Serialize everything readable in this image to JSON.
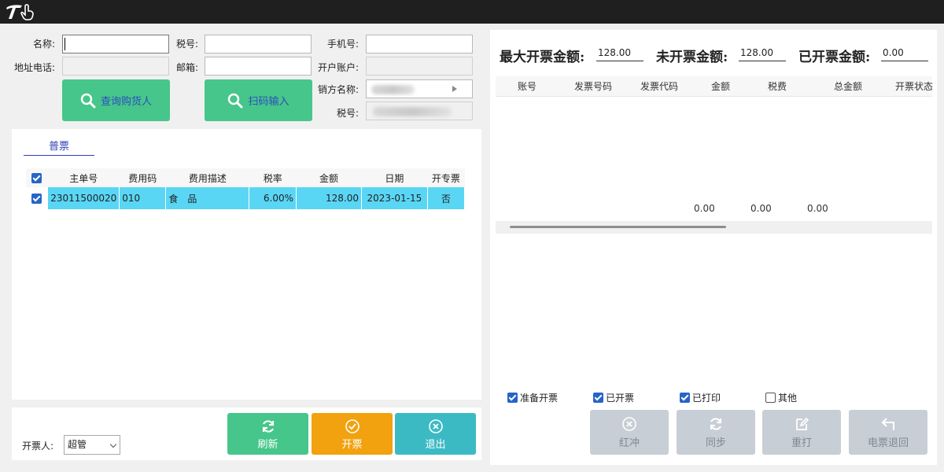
{
  "form": {
    "name_label": "名称:",
    "name_value": "",
    "tax_label": "税号:",
    "tax_value": "",
    "phone_label": "手机号:",
    "phone_value": "",
    "address_label": "地址电话:",
    "address_value": "",
    "email_label": "邮箱:",
    "email_value": "",
    "account_label": "开户账户:",
    "account_value": "",
    "seller_label": "销方名称:",
    "seller_tax_label": "税号:"
  },
  "buttons": {
    "query_buyer": "查询购货人",
    "scan_input": "扫码输入",
    "refresh": "刷新",
    "issue": "开票",
    "exit": "退出",
    "red_reverse": "红冲",
    "sync": "同步",
    "reprint": "重打",
    "e_invoice_return": "电票退回"
  },
  "tab": {
    "label": "普票"
  },
  "left_table": {
    "headers": [
      "主单号",
      "费用码",
      "费用描述",
      "税率",
      "金额",
      "日期",
      "开专票"
    ],
    "rows": [
      {
        "order_no": "23011500020",
        "fee_code": "010",
        "fee_desc": "食　品",
        "tax_rate": "6.00%",
        "amount": "128.00",
        "date": "2023-01-15",
        "special": "否"
      }
    ]
  },
  "issuer": {
    "label": "开票人:",
    "value": "超管"
  },
  "stats": {
    "max_label": "最大开票金额:",
    "max_value": "128.00",
    "unissued_label": "未开票金额:",
    "unissued_value": "128.00",
    "issued_label": "已开票金额:",
    "issued_value": "0.00"
  },
  "right_table": {
    "headers": [
      "账号",
      "发票号码",
      "发票代码",
      "金额",
      "税费",
      "总金额",
      "开票状态"
    ],
    "totals": {
      "amount": "0.00",
      "tax": "0.00",
      "total": "0.00"
    }
  },
  "filters": [
    {
      "label": "准备开票",
      "checked": true
    },
    {
      "label": "已开票",
      "checked": true
    },
    {
      "label": "已打印",
      "checked": true
    },
    {
      "label": "其他",
      "checked": false
    }
  ],
  "colors": {
    "accent_green": "#46c68a",
    "accent_orange": "#f2a20f",
    "accent_teal": "#3bbac4",
    "row_highlight": "#5ad6f5"
  }
}
